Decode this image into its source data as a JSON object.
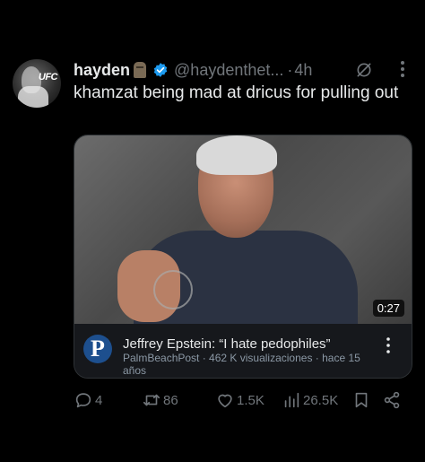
{
  "tweet": {
    "author_name": "hayden",
    "author_handle": "@haydenthet...",
    "separator": "·",
    "timestamp": "4h",
    "text": "khamzat being mad at dricus for pulling out",
    "avatar_text": "UFC"
  },
  "card": {
    "duration": "0:27",
    "logo_letter": "P",
    "title": "Jeffrey Epstein: “I hate pedophiles”",
    "meta": "PalmBeachPost · 462 K visualizaciones · hace 15 años"
  },
  "actions": {
    "replies": "4",
    "retweets": "86",
    "likes": "1.5K",
    "views": "26.5K"
  },
  "colors": {
    "background": "#000000",
    "text_primary": "#e7e9ea",
    "text_secondary": "#71767b",
    "verified_blue": "#1d9bf0"
  },
  "icons": [
    "verified-badge-icon",
    "grok-icon",
    "more-icon",
    "reply-icon",
    "retweet-icon",
    "like-icon",
    "views-icon",
    "bookmark-icon",
    "share-icon"
  ]
}
